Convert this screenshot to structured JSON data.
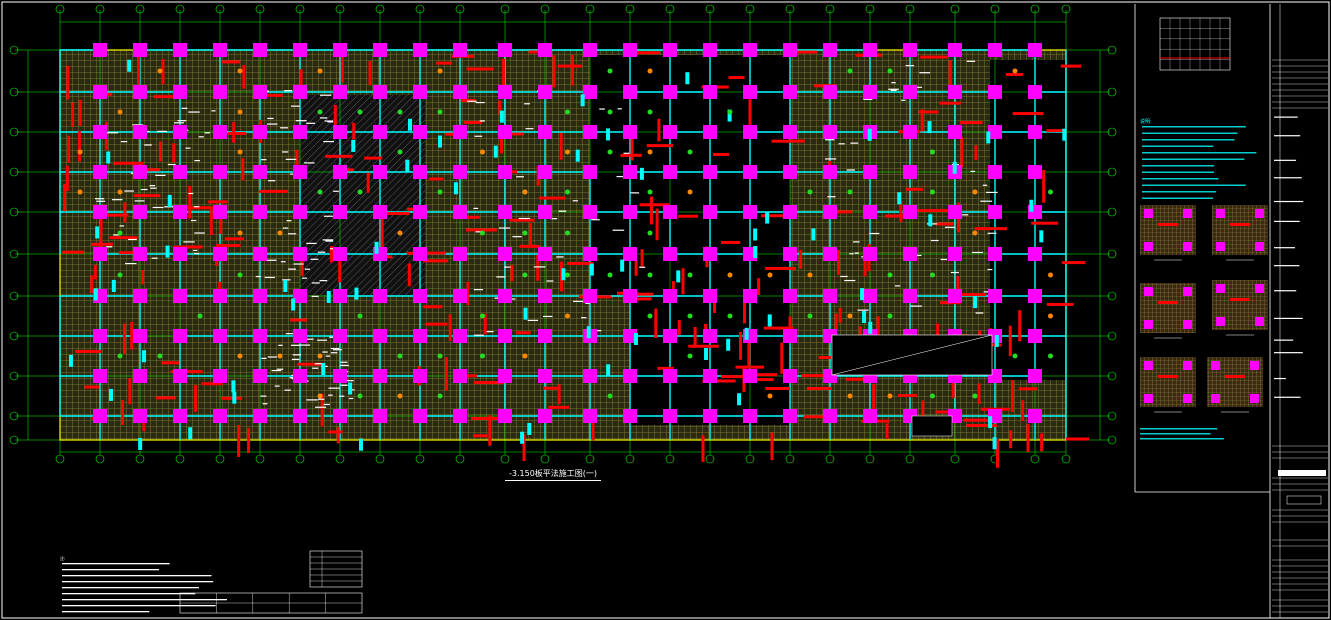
{
  "drawing": {
    "plan_title": "-3.150板平法施工图(一)",
    "colors": {
      "background": "#000000",
      "grid_line": "#00ff00",
      "outline": "#ffff00",
      "column": "#ff00ff",
      "beam": "#00ffff",
      "red_mark": "#ff0000",
      "slab_mesh": "#7f7f3f",
      "text": "#ffffff",
      "frame": "#ffffff"
    },
    "notes": {
      "title": "说明:"
    },
    "general_notes": {
      "title": "注:"
    }
  }
}
